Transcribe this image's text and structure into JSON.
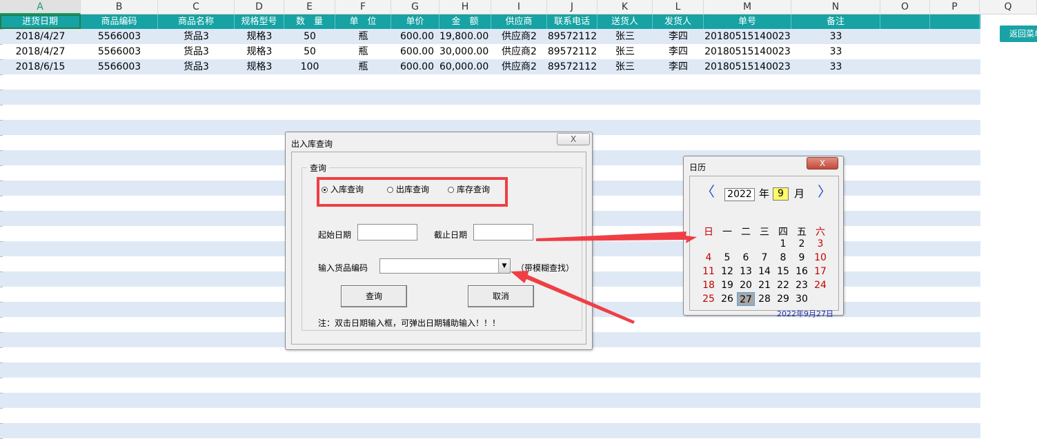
{
  "sheet": {
    "column_letters": [
      "A",
      "B",
      "C",
      "D",
      "E",
      "F",
      "G",
      "H",
      "I",
      "J",
      "K",
      "L",
      "M",
      "N",
      "O",
      "P",
      "Q"
    ],
    "active_column": "A",
    "headers": [
      "进货日期",
      "商品编码",
      "商品名称",
      "规格型号",
      "数　量",
      "单　位",
      "单价",
      "金　额",
      "供应商",
      "联系电话",
      "送货人",
      "发货人",
      "单号",
      "备注"
    ],
    "rows": [
      [
        "2018/4/27",
        "5566003",
        "货品3",
        "规格3",
        "50",
        "瓶",
        "600.00",
        "19,800.00",
        "供应商2",
        "89572112",
        "张三",
        "李四",
        "20180515140023",
        "33"
      ],
      [
        "2018/4/27",
        "5566003",
        "货品3",
        "规格3",
        "50",
        "瓶",
        "600.00",
        "30,000.00",
        "供应商2",
        "89572112",
        "张三",
        "李四",
        "20180515140023",
        "33"
      ],
      [
        "2018/6/15",
        "5566003",
        "货品3",
        "规格3",
        "100",
        "瓶",
        "600.00",
        "60,000.00",
        "供应商2",
        "89572112",
        "张三",
        "李四",
        "20180515140023",
        "33"
      ]
    ],
    "return_button": "返回菜单",
    "colors": {
      "header_bg": "#17a2a3",
      "stripe": "#dfe9f6",
      "active_col": "#1a9c68"
    }
  },
  "dialog": {
    "title": "出入库查询",
    "close_symbol": "X",
    "group_label": "查询",
    "radios": [
      {
        "label": "入库查询",
        "checked": true
      },
      {
        "label": "出库查询",
        "checked": false
      },
      {
        "label": "库存查询",
        "checked": false
      }
    ],
    "start_date_label": "起始日期",
    "start_date_value": "",
    "end_date_label": "截止日期",
    "end_date_value": "",
    "code_label": "输入货品编码",
    "code_value": "",
    "code_hint": "（带模糊查找）",
    "query_button": "查询",
    "cancel_button": "取消",
    "note": "注：双击日期输入框，可弹出日期辅助输入！！！"
  },
  "calendar": {
    "title": "日历",
    "close_symbol": "X",
    "prev_symbol": "〈",
    "next_symbol": "〉",
    "year": "2022",
    "year_word": "年",
    "month": "9",
    "month_word": "月",
    "day_names": [
      "日",
      "一",
      "二",
      "三",
      "四",
      "五",
      "六"
    ],
    "weeks": [
      [
        "",
        "",
        "",
        "",
        "1",
        "2",
        "3"
      ],
      [
        "4",
        "5",
        "6",
        "7",
        "8",
        "9",
        "10"
      ],
      [
        "11",
        "12",
        "13",
        "14",
        "15",
        "16",
        "17"
      ],
      [
        "18",
        "19",
        "20",
        "21",
        "22",
        "23",
        "24"
      ],
      [
        "25",
        "26",
        "27",
        "28",
        "29",
        "30",
        ""
      ]
    ],
    "selected_day": "27",
    "today_text": "2022年9月27日"
  }
}
